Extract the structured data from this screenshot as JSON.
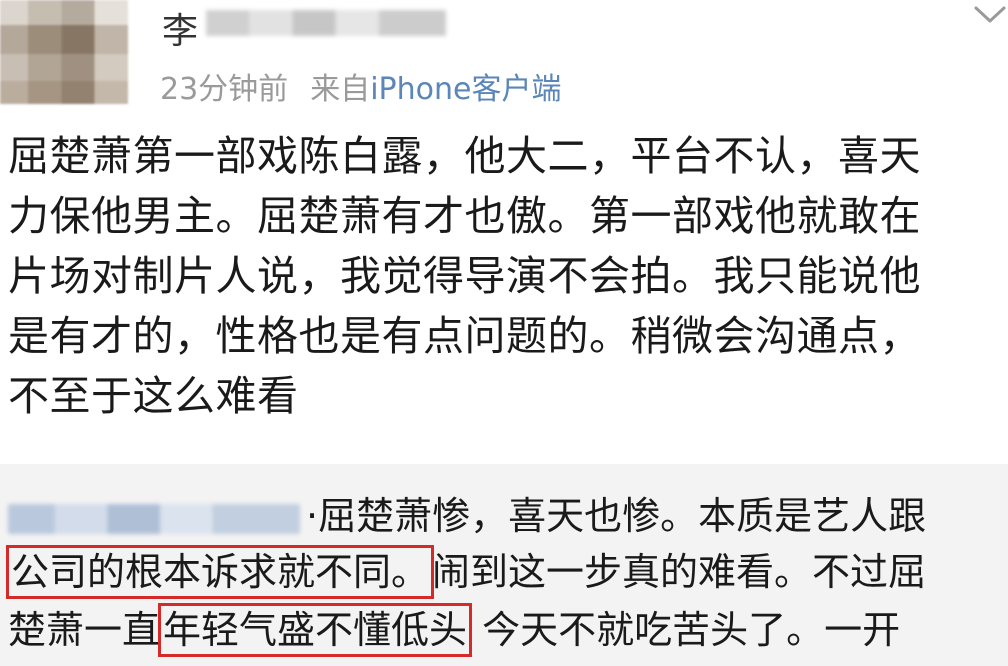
{
  "post": {
    "author_visible_char": "李",
    "meta": {
      "time": "23分钟前",
      "source_prefix": "来自",
      "source": "iPhone客户端"
    },
    "body_lines": [
      "屈楚萧第一部戏陈白露，他大二，平台不认，喜天",
      "力保他男主。屈楚萧有才也傲。第一部戏他就敢在",
      "片场对制片人说，我觉得导演不会拍。我只能说他",
      "是有才的，性格也是有点问题的。稍微会沟通点，",
      "不至于这么难看"
    ]
  },
  "comment": {
    "line1_text": "·屈楚萧惨，喜天也惨。本质是艺人跟",
    "line2_highlight": "公司的根本诉求就不同。",
    "line2_rest": "闹到这一步真的难看。不过屈",
    "line3_prefix": "楚萧一直",
    "line3_highlight": "年轻气盛不懂低头",
    "line3_rest": " 今天不就吃苦头了。一开"
  },
  "colors": {
    "highlight_border": "#d42a2a",
    "source_link": "#5a86b8",
    "meta_gray": "#9a9a9a",
    "comment_bg": "#f3f3f3"
  },
  "icons": {
    "expand": "chevron-down-icon"
  }
}
